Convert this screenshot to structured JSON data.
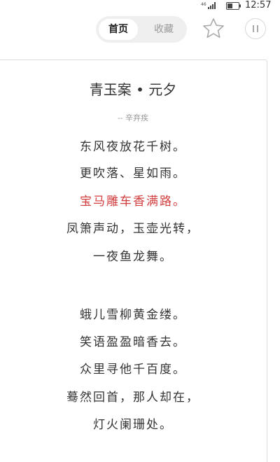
{
  "status_bar": {
    "time": "12:57",
    "icons": [
      "signal-icon",
      "battery-icon"
    ]
  },
  "tabs": [
    {
      "label": "首页",
      "selected": true
    },
    {
      "label": "收藏",
      "selected": false
    }
  ],
  "toolbar": {
    "icons": [
      "star-icon",
      "pause-icon"
    ]
  },
  "poem": {
    "title": "青玉案 • 元夕",
    "author": "-- 辛弃疾",
    "stanzas": [
      [
        "东风夜放花千树。",
        "更吹落、星如雨。",
        "宝马雕车香满路。",
        "凤箫声动，玉壶光转，",
        "一夜鱼龙舞。"
      ],
      [
        "蛾儿雪柳黄金缕。",
        "笑语盈盈暗香去。",
        "众里寻他千百度。",
        "蓦然回首，那人却在，",
        "灯火阑珊处。"
      ]
    ],
    "highlight_color": "#d23c3c",
    "text_color": "#333333"
  }
}
